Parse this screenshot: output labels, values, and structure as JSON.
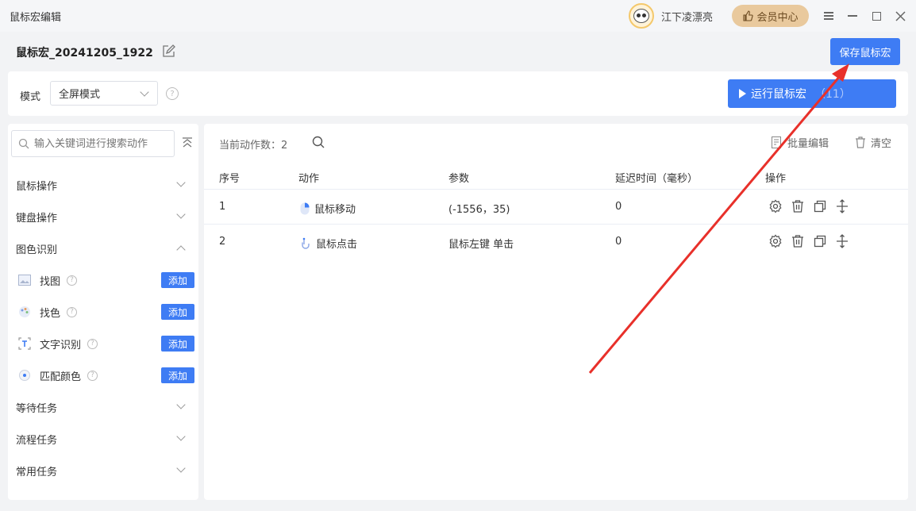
{
  "app": {
    "title": "鼠标宏编辑",
    "username": "江下凌漂亮",
    "vip_label": "会员中心"
  },
  "header": {
    "macro_name": "鼠标宏_20241205_1922",
    "save_label": "保存鼠标宏"
  },
  "mode": {
    "label": "模式",
    "selected": "全屏模式",
    "help": "?",
    "run_label": "运行鼠标宏",
    "run_count": "（11）"
  },
  "sidebar": {
    "search_placeholder": "输入关键词进行搜索动作",
    "categories": [
      {
        "label": "鼠标操作",
        "expanded": false
      },
      {
        "label": "键盘操作",
        "expanded": false
      },
      {
        "label": "图色识别",
        "expanded": true
      },
      {
        "label": "等待任务",
        "expanded": false
      },
      {
        "label": "流程任务",
        "expanded": false
      },
      {
        "label": "常用任务",
        "expanded": false
      }
    ],
    "sub_items": [
      {
        "label": "找图",
        "icon": "image-icon",
        "help": "?",
        "add": "添加"
      },
      {
        "label": "找色",
        "icon": "palette-icon",
        "help": "?",
        "add": "添加"
      },
      {
        "label": "文字识别",
        "icon": "text-recognition-icon",
        "help": "?",
        "add": "添加"
      },
      {
        "label": "匹配颜色",
        "icon": "color-match-icon",
        "help": "?",
        "add": "添加"
      }
    ]
  },
  "main": {
    "count_label": "当前动作数：2",
    "batch_edit": "批量编辑",
    "clear": "清空",
    "columns": [
      "序号",
      "动作",
      "参数",
      "延迟时间（毫秒）",
      "操作"
    ],
    "rows": [
      {
        "index": "1",
        "action": "鼠标移动",
        "action_icon": "mouse-move-icon",
        "param": "(-1556，35)",
        "delay": "0"
      },
      {
        "index": "2",
        "action": "鼠标点击",
        "action_icon": "mouse-click-icon",
        "param": "鼠标左键 单击",
        "delay": "0"
      }
    ]
  },
  "colors": {
    "primary": "#3e7cf4",
    "vip_bg": "#e9c99d",
    "annotation_arrow": "#e8302a"
  }
}
